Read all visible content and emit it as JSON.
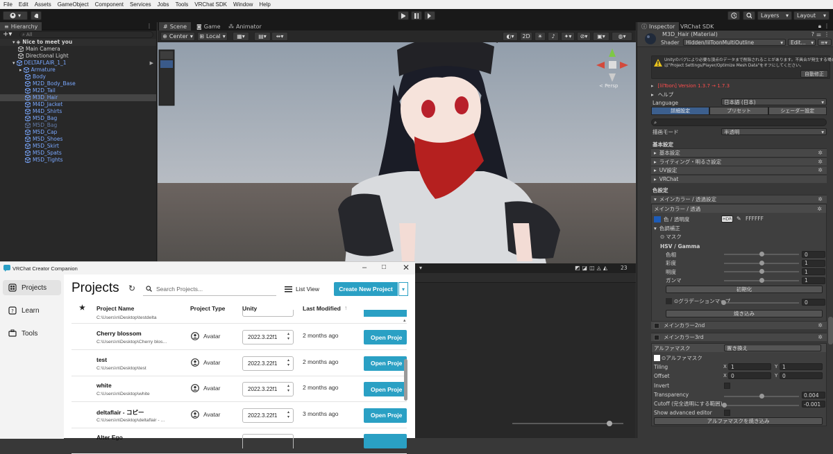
{
  "menubar": [
    "File",
    "Edit",
    "Assets",
    "GameObject",
    "Component",
    "Services",
    "Jobs",
    "Tools",
    "VRChat SDK",
    "Window",
    "Help"
  ],
  "toolbar": {
    "layers": "Layers",
    "layout": "Layout"
  },
  "hierarchy": {
    "tab": "Hierarchy",
    "search_placeholder": "All",
    "scene": "Nice to meet you",
    "items": [
      {
        "label": "Main Camera",
        "indent": 1,
        "style": "normal"
      },
      {
        "label": "Directional Light",
        "indent": 1,
        "style": "normal"
      },
      {
        "label": "DELTAFLAIR_1_1",
        "indent": 1,
        "style": "blue"
      },
      {
        "label": "Armature",
        "indent": 2,
        "style": "blue"
      },
      {
        "label": "Body",
        "indent": 2,
        "style": "blue"
      },
      {
        "label": "M2D_Body_Base",
        "indent": 2,
        "style": "blue"
      },
      {
        "label": "M2D_Tail",
        "indent": 2,
        "style": "blue"
      },
      {
        "label": "M3D_Hair",
        "indent": 2,
        "style": "blue",
        "selected": true
      },
      {
        "label": "M4D_Jacket",
        "indent": 2,
        "style": "blue"
      },
      {
        "label": "M4D_Shirts",
        "indent": 2,
        "style": "blue"
      },
      {
        "label": "M5D_Bag",
        "indent": 2,
        "style": "blue"
      },
      {
        "label": "M5D_Bag",
        "indent": 2,
        "style": "dim"
      },
      {
        "label": "M5D_Cap",
        "indent": 2,
        "style": "blue"
      },
      {
        "label": "M5D_Shoes",
        "indent": 2,
        "style": "blue"
      },
      {
        "label": "M5D_Skirt",
        "indent": 2,
        "style": "blue"
      },
      {
        "label": "M5D_Spats",
        "indent": 2,
        "style": "blue"
      },
      {
        "label": "M5D_Tights",
        "indent": 2,
        "style": "blue"
      }
    ]
  },
  "scene": {
    "tabs": [
      "Scene",
      "Game",
      "Animator"
    ],
    "pivot": "Center",
    "space": "Local",
    "mode_2d": "2D",
    "persp": "< Persp",
    "gizmo_count": "23"
  },
  "inspector": {
    "tabs": [
      "Inspector",
      "VRChat SDK"
    ],
    "material_title": "M3D_Hair (Material)",
    "shader_label": "Shader",
    "shader_value": "Hidden/lilToonMultiOutline",
    "edit_button": "Edit...",
    "warning_line1": "Unityのバグにより必要な頂点のデータまで削除されることがあります。不具合が発生する場合",
    "warning_line2": "は\"Project Settings/Player/Optimize Mesh Data\"をオフにしてください。",
    "auto_fix": "自動修正",
    "version_label": "[lilToon] Version 1.3.7 → 1.7.3",
    "help": "ヘルプ",
    "language_label": "Language",
    "language_value": "日本語 (日本)",
    "mode_tabs": [
      "詳細設定",
      "プリセット",
      "シェーダー設定"
    ],
    "render_mode_label": "描画モード",
    "render_mode_value": "半透明",
    "basic_header": "基本設定",
    "basic_items": [
      "基本設定",
      "ライティング・明るさ設定",
      "UV設定",
      "VRChat"
    ],
    "color_header": "色設定",
    "main_color_fold": "メインカラー / 透過設定",
    "main_color_sub": "メインカラー / 透過",
    "color_alpha_label": "色 / 透明度",
    "hdr": "HDR",
    "color_hex": "FFFFFF",
    "color_correction": "色調補正",
    "mask": "マスク",
    "hsv_header": "HSV / Gamma",
    "hsv": [
      {
        "label": "色相",
        "value": "0",
        "fraction": 0.5
      },
      {
        "label": "彩度",
        "value": "1",
        "fraction": 0.5
      },
      {
        "label": "明度",
        "value": "1",
        "fraction": 0.5
      },
      {
        "label": "ガンマ",
        "value": "1",
        "fraction": 0.5
      }
    ],
    "reset": "初期化",
    "gradation_label": "グラデーションマップ",
    "gradation_value": "0",
    "bake": "焼き込み",
    "main2": "メインカラー2nd",
    "main3": "メインカラー3rd",
    "alpha_mask_label": "アルファマスク",
    "alpha_mask_mode": "置き換え",
    "alpha_mask_tex": "アルファマスク",
    "tiling_label": "Tiling",
    "tiling_x": "1",
    "tiling_y": "1",
    "offset_label": "Offset",
    "offset_x": "0",
    "offset_y": "0",
    "invert_label": "Invert",
    "transparency_label": "Transparency",
    "transparency_value": "0.004",
    "transparency_fraction": 0.5,
    "cutoff_label": "Cutoff (完全透明にする範囲)",
    "cutoff_value": "-0.001",
    "cutoff_fraction": 0.0,
    "advanced_label": "Show advanced editor",
    "bake_alpha": "アルファマスクを焼き込み"
  },
  "vcc": {
    "title": "VRChat Creator Companion",
    "nav": [
      "Projects",
      "Learn",
      "Tools"
    ],
    "heading": "Projects",
    "search_placeholder": "Search Projects...",
    "list_view": "List View",
    "create": "Create New Project",
    "columns": [
      "Project Name",
      "Project Type",
      "Unity",
      "Last Modified"
    ],
    "partial_path": "C:\\Users\\n\\Desktop\\testdelta",
    "projects": [
      {
        "name": "Cherry blossom",
        "path": "C:\\Users\\n\\Desktop\\Cherry blos...",
        "type": "Avatar",
        "unity": "2022.3.22f1",
        "modified": "2 months ago",
        "open": "Open Proje"
      },
      {
        "name": "test",
        "path": "C:\\Users\\n\\Desktop\\test",
        "type": "Avatar",
        "unity": "2022.3.22f1",
        "modified": "2 months ago",
        "open": "Open Proje"
      },
      {
        "name": "white",
        "path": "C:\\Users\\n\\Desktop\\white",
        "type": "Avatar",
        "unity": "2022.3.22f1",
        "modified": "2 months ago",
        "open": "Open Proje"
      },
      {
        "name": "deltaflair - コピー",
        "path": "C:\\Users\\n\\Desktop\\deltaflair - ...",
        "type": "Avatar",
        "unity": "2022.3.22f1",
        "modified": "3 months ago",
        "open": "Open Proje"
      },
      {
        "name": "Alter Ego",
        "path": "",
        "type": "",
        "unity": "",
        "modified": "",
        "open": ""
      }
    ]
  }
}
